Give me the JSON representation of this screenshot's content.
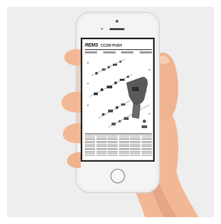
{
  "screen_document": {
    "brand": "REMS",
    "model_header": "CC220 PUSH"
  },
  "icons": {
    "front_camera": "camera-icon",
    "earpiece": "speaker-icon",
    "home_button": "home-button-icon"
  },
  "colors": {
    "background": "#eeeeee",
    "phone_body": "#f4f4f4",
    "phone_edge": "#d9d9d9",
    "skin": "#f2b896",
    "skin_shadow": "#d9987a"
  }
}
